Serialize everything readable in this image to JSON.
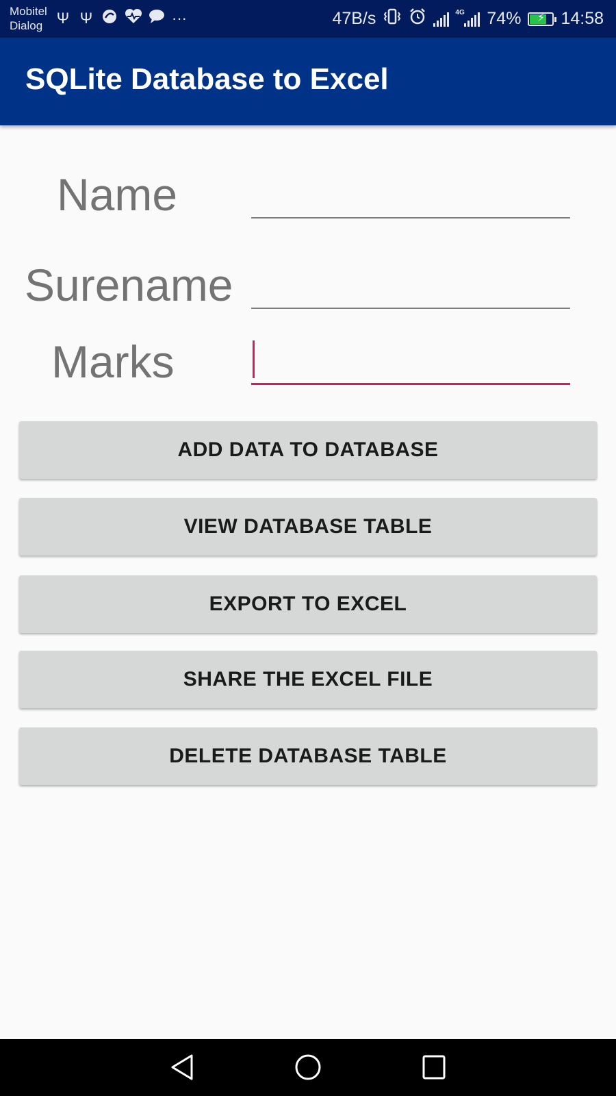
{
  "status_bar": {
    "carrier_line1": "Mobitel",
    "carrier_line2": "Dialog",
    "left_icons": [
      "usb-icon",
      "usb-icon",
      "swirl-icon",
      "health-icon",
      "chat-icon"
    ],
    "more": "···",
    "net_speed": "47B/s",
    "network": "4G",
    "battery": "74%",
    "battery_level": 0.74,
    "time": "14:58"
  },
  "app_bar": {
    "title": "SQLite Database to Excel"
  },
  "form": {
    "name_label": "Name",
    "surname_label": "Surename",
    "marks_label": "Marks",
    "name_value": "",
    "surname_value": "",
    "marks_value": ""
  },
  "buttons": {
    "add": "ADD DATA TO DATABASE",
    "view": "VIEW DATABASE TABLE",
    "export": "EXPORT TO EXCEL",
    "share": "SHARE THE EXCEL FILE",
    "delete": "DELETE DATABASE TABLE"
  },
  "nav_bar": {
    "icons": [
      "back-icon",
      "home-icon",
      "recents-icon"
    ]
  },
  "colors": {
    "status_bar": "#011b5c",
    "app_bar": "#003388",
    "accent": "#d81b60",
    "button": "#d6d7d7",
    "label": "#737373"
  }
}
